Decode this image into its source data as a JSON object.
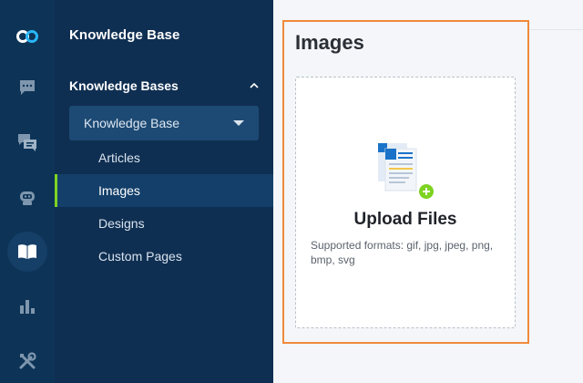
{
  "rail": {
    "items": [
      {
        "icon": "app-logo-icon"
      },
      {
        "icon": "chat-icon"
      },
      {
        "icon": "messages-icon"
      },
      {
        "icon": "bot-icon"
      },
      {
        "icon": "knowledge-base-icon",
        "active": true
      },
      {
        "icon": "reports-icon"
      },
      {
        "icon": "settings-tools-icon"
      }
    ]
  },
  "sidebar": {
    "title": "Knowledge Base",
    "section_label": "Knowledge Bases",
    "selected_kb": "Knowledge Base",
    "items": [
      {
        "label": "Articles"
      },
      {
        "label": "Images",
        "active": true
      },
      {
        "label": "Designs"
      },
      {
        "label": "Custom Pages"
      }
    ]
  },
  "main": {
    "title": "Images",
    "upload": {
      "label": "Upload Files",
      "formats": "Supported formats: gif, jpg, jpeg, png, bmp, svg"
    }
  },
  "colors": {
    "rail_bg": "#0d3457",
    "sidebar_bg": "#0f2f52",
    "active_indicator": "#7ed321",
    "highlight_border": "#f08a3c",
    "accent_blue": "#1a73c9"
  }
}
